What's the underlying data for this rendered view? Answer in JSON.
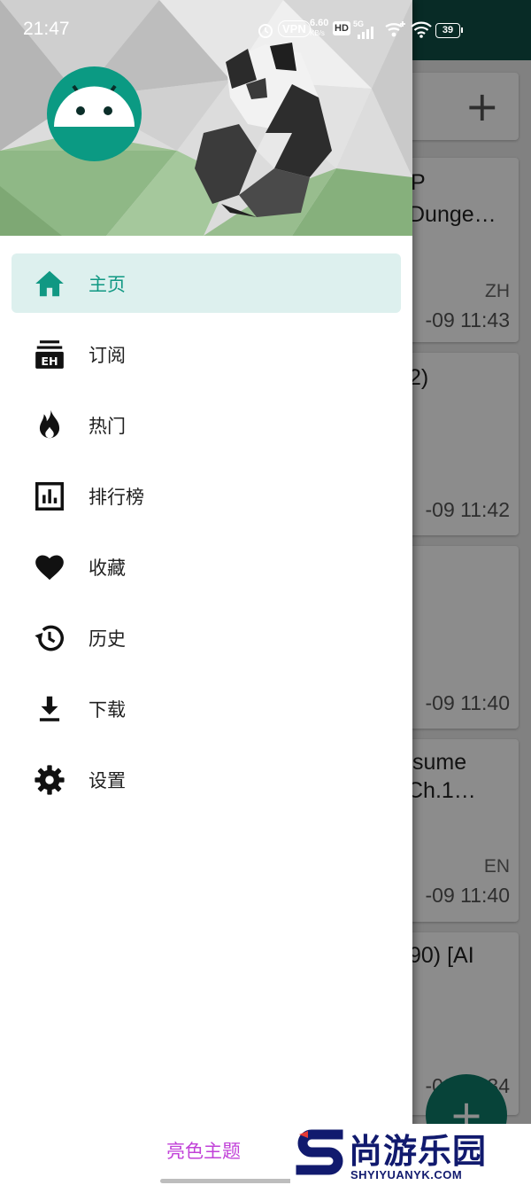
{
  "status_bar": {
    "time": "21:47",
    "vpn": "VPN",
    "speed_value": "6.60",
    "speed_unit": "KB/s",
    "hd": "HD",
    "network": "5G",
    "battery": "39"
  },
  "drawer": {
    "items": [
      {
        "label": "主页",
        "icon": "home-icon",
        "active": true
      },
      {
        "label": "订阅",
        "icon": "subscription-icon",
        "active": false
      },
      {
        "label": "热门",
        "icon": "fire-icon",
        "active": false
      },
      {
        "label": "排行榜",
        "icon": "bar-chart-icon",
        "active": false
      },
      {
        "label": "收藏",
        "icon": "heart-icon",
        "active": false
      },
      {
        "label": "历史",
        "icon": "history-icon",
        "active": false
      },
      {
        "label": "下载",
        "icon": "download-icon",
        "active": false
      },
      {
        "label": "设置",
        "icon": "gear-icon",
        "active": false
      }
    ],
    "theme_label": "亮色主题",
    "active_color": "#109883",
    "active_bg": "#ddf0ee"
  },
  "background_list": {
    "add_icon": "+",
    "cards": [
      {
        "line1": "P",
        "line2": "Dunge…",
        "lang": "ZH",
        "time": "-09 11:43"
      },
      {
        "line1": "2)",
        "line2": "",
        "lang": "",
        "time": "-09 11:42"
      },
      {
        "line1": "",
        "line2": "",
        "lang": "",
        "time": "-09 11:40"
      },
      {
        "line1": "sume",
        "line2": "Ch.1…",
        "lang": "EN",
        "time": "-09 11:40"
      },
      {
        "line1": "90) [AI",
        "line2": "",
        "lang": "",
        "time": "-09 11:34"
      }
    ]
  },
  "watermark": {
    "text": "尚游乐园",
    "url": "SHYIYUANYK.COM",
    "color": "#111a6e"
  }
}
